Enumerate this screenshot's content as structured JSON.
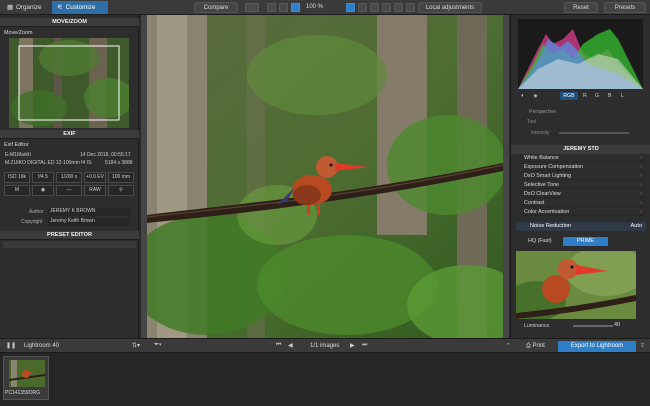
{
  "tabs": {
    "organize": "Organize",
    "customize": "Customize"
  },
  "toolbar": {
    "compare": "Compare",
    "zoom": "100 %",
    "local_adjustments": "Local adjustments",
    "reset": "Reset",
    "presets": "Presets"
  },
  "left": {
    "move_zoom_header": "MOVE/ZOOM",
    "move_zoom_label": "Move/Zoom",
    "exif_header": "EXIF",
    "exif_editor_label": "Exif Editor",
    "camera": "E-M1MarkII",
    "date": "14 Dec 2018, 00:55:17",
    "lens": "M.ZUIKO DIGITAL ED 12-100mm f4 IS·",
    "dimensions": "5184 x 3888",
    "iso": "ISO 16k",
    "aperture": "f/4.5",
    "shutter": "1/200 s",
    "ev": "+0.0 EV",
    "focal": "100 mm",
    "mode": "M",
    "metering": "—",
    "format": "RAW",
    "author_label": "Author",
    "author_value": "JEREMY K BROWN",
    "copyright_label": "Copyright",
    "copyright_value": "Jeremy Keith Brown",
    "preset_editor_header": "PRESET EDITOR"
  },
  "right": {
    "channels": [
      "RGB",
      "R",
      "G",
      "B",
      "L"
    ],
    "perspective": "Perspective",
    "tool_label": "Tool",
    "intensity_label": "Intensity",
    "preset_header": "JEREMY STD",
    "items": [
      "White Balance",
      "Exposure Compensation",
      "DxO Smart Lighting",
      "Selective Tone",
      "DxO ClearView",
      "Contrast",
      "Color Accentuation"
    ],
    "noise_reduction": "Noise Reduction",
    "auto": "Auto",
    "hq": "HQ (Fast)",
    "prime": "PRIME",
    "luminance_label": "Luminance",
    "luminance_value": "40"
  },
  "bottom": {
    "folder": "Lightroom 40",
    "images": "1/1 images",
    "print": "Print",
    "export": "Export to Lightroom"
  },
  "film": {
    "filename": "PC141359ORG"
  }
}
